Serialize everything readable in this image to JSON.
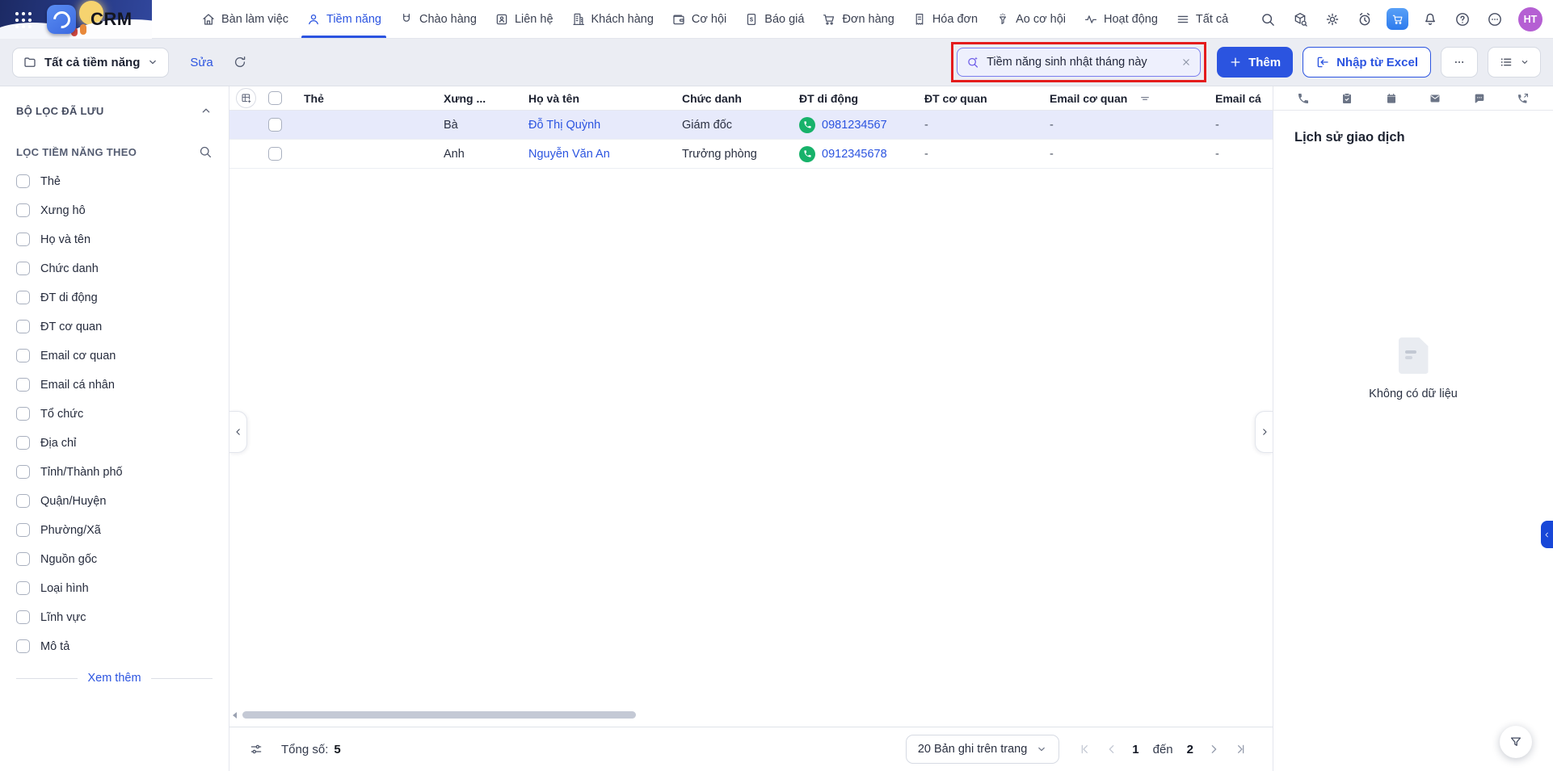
{
  "app": {
    "name": "CRM"
  },
  "nav": {
    "items": [
      {
        "label": "Bàn làm việc",
        "icon": "home-icon"
      },
      {
        "label": "Tiềm năng",
        "icon": "lead-user-icon",
        "active": true
      },
      {
        "label": "Chào hàng",
        "icon": "magnet-icon"
      },
      {
        "label": "Liên hệ",
        "icon": "contact-card-icon"
      },
      {
        "label": "Khách hàng",
        "icon": "building-icon"
      },
      {
        "label": "Cơ hội",
        "icon": "wallet-icon"
      },
      {
        "label": "Báo giá",
        "icon": "quote-icon"
      },
      {
        "label": "Đơn hàng",
        "icon": "cart-icon"
      },
      {
        "label": "Hóa đơn",
        "icon": "invoice-icon"
      },
      {
        "label": "Ao cơ hội",
        "icon": "funnel-dots-icon"
      },
      {
        "label": "Hoạt động",
        "icon": "activity-icon"
      },
      {
        "label": "Tất cả",
        "icon": "menu-icon"
      }
    ],
    "avatar_initials": "HT"
  },
  "toolbar": {
    "view_selector": "Tất cả tiềm năng",
    "edit_link": "Sửa",
    "search_value": "Tiềm năng sinh nhật tháng này",
    "add_button": "Thêm",
    "import_button": "Nhập từ Excel"
  },
  "sidebar": {
    "saved_filters_title": "BỘ LỌC ĐÃ LƯU",
    "filter_by_title": "LỌC TIỀM NĂNG THEO",
    "filters": [
      "Thẻ",
      "Xưng hô",
      "Họ và tên",
      "Chức danh",
      "ĐT di động",
      "ĐT cơ quan",
      "Email cơ quan",
      "Email cá nhân",
      "Tổ chức",
      "Địa chỉ",
      "Tỉnh/Thành phố",
      "Quận/Huyện",
      "Phường/Xã",
      "Nguồn gốc",
      "Loại hình",
      "Lĩnh vực",
      "Mô tả"
    ],
    "show_more": "Xem thêm"
  },
  "table": {
    "columns": [
      "Thẻ",
      "Xưng ...",
      "Họ và tên",
      "Chức danh",
      "ĐT di động",
      "ĐT cơ quan",
      "Email cơ quan",
      "Email cá"
    ],
    "rows": [
      {
        "tag": "",
        "salutation": "Bà",
        "name": "Đỗ Thị Quỳnh",
        "title": "Giám đốc",
        "mobile": "0981234567",
        "office_phone": "-",
        "office_email": "-",
        "personal_email": "-"
      },
      {
        "tag": "",
        "salutation": "Anh",
        "name": "Nguyễn Văn An",
        "title": "Trưởng phòng",
        "mobile": "0912345678",
        "office_phone": "-",
        "office_email": "-",
        "personal_email": "-"
      }
    ]
  },
  "detail_panel": {
    "title": "Lịch sử giao dịch",
    "empty_text": "Không có dữ liệu"
  },
  "footer": {
    "total_label": "Tổng số:",
    "total_value": "5",
    "page_size": "20 Bản ghi trên trang",
    "page_from": "1",
    "page_to_label": "đến",
    "page_to": "2"
  },
  "colors": {
    "accent": "#2b54e0",
    "annotation_red": "#e41c1c",
    "phone_green": "#17b26a",
    "avatar_purple": "#b55fd3",
    "row_highlight": "#e7eafb"
  }
}
